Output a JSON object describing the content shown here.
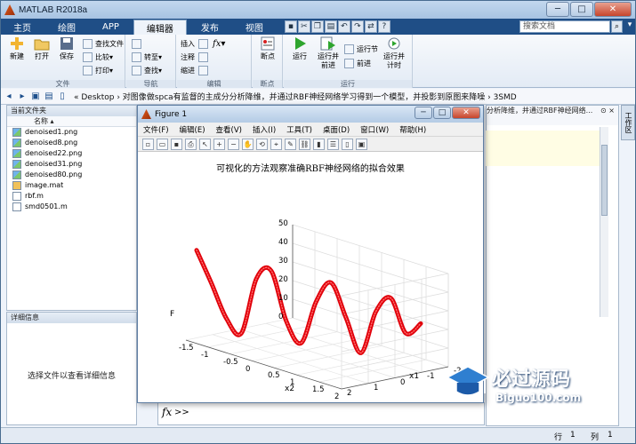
{
  "window": {
    "title": "MATLAB R2018a"
  },
  "tabs": [
    "主页",
    "绘图",
    "APP",
    "编辑器",
    "发布",
    "视图"
  ],
  "active_tab": "编辑器",
  "search": {
    "placeholder": "搜索文档"
  },
  "ribbon": {
    "file": {
      "new": "新建",
      "open": "打开",
      "save": "保存",
      "find_files": "查找文件",
      "compare": "比较",
      "print": "打印",
      "group": "文件"
    },
    "nav": {
      "goto": "转至",
      "find": "查找",
      "group": "导航"
    },
    "edit": {
      "insert": "插入",
      "comment": "注释",
      "indent": "缩进",
      "fx": "fx",
      "group": "编辑"
    },
    "breakpoints": {
      "breakpoint": "断点",
      "group": "断点"
    },
    "run": {
      "run": "运行",
      "run_advance": "运行并\n前进",
      "run_section": "运行节",
      "advance": "前进",
      "run_time": "运行并\n计时",
      "group": "运行"
    }
  },
  "address": {
    "path": "« Desktop › 对图像做spca有监督的主成分分析降维，并通过RBF神经网络学习得到一个模型，并投影到原图来降噪 › 3SMD",
    "right_fragment": "分析降维，并通过RBF神经网络..."
  },
  "current_folder": {
    "title": "当前文件夹",
    "column": "名称",
    "files": [
      {
        "name": "denoised1.png",
        "type": "png"
      },
      {
        "name": "denoised8.png",
        "type": "png"
      },
      {
        "name": "denoised22.png",
        "type": "png"
      },
      {
        "name": "denoised31.png",
        "type": "png"
      },
      {
        "name": "denoised80.png",
        "type": "png"
      },
      {
        "name": "image.mat",
        "type": "mat"
      },
      {
        "name": "rbf.m",
        "type": "m"
      },
      {
        "name": "smd0501.m",
        "type": "m"
      }
    ]
  },
  "details": {
    "title": "详细信息",
    "empty_text": "选择文件以查看详细信息"
  },
  "workspace_tab": "工作区",
  "command": {
    "fx": "fx",
    "prompt": ">>"
  },
  "status": {
    "row_label": "行",
    "row": "1",
    "col_label": "列",
    "col": "1"
  },
  "figure": {
    "title": "Figure 1",
    "menu": [
      "文件(F)",
      "编辑(E)",
      "查看(V)",
      "插入(I)",
      "工具(T)",
      "桌面(D)",
      "窗口(W)",
      "帮助(H)"
    ]
  },
  "chart_data": {
    "type": "line",
    "title": "可视化的方法观察准确RBF神经网络的拟合效果",
    "xlabel": "x1",
    "ylabel": "x2",
    "zlabel": "F",
    "x_ticks": [
      "-1.5",
      "-1",
      "-0.5",
      "0",
      "0.5",
      "1",
      "1.5",
      "2"
    ],
    "y_ticks": [
      "-2",
      "-1",
      "0",
      "1",
      "2"
    ],
    "z_ticks": [
      "0",
      "10",
      "20",
      "30",
      "40",
      "50"
    ],
    "xlim": [
      -2,
      2
    ],
    "ylim": [
      -1.5,
      2
    ],
    "zlim": [
      0,
      50
    ],
    "grid": true,
    "series": [
      {
        "color": "#e0000a",
        "description": "RBF fitted curve F(x1,x2), oscillating sinusoid along diagonal",
        "x2": [
          -1.5,
          -1.3,
          -1.1,
          -0.9,
          -0.7,
          -0.5,
          -0.3,
          -0.1,
          0.1,
          0.3,
          0.5,
          0.7,
          0.9,
          1.1,
          1.3,
          1.5
        ],
        "F": [
          47,
          30,
          12,
          5,
          35,
          40,
          14,
          3,
          26,
          37,
          19,
          1,
          24,
          32,
          14,
          20
        ]
      }
    ]
  },
  "watermark": {
    "main": "必过源码",
    "sub": "Biguo100.com"
  }
}
